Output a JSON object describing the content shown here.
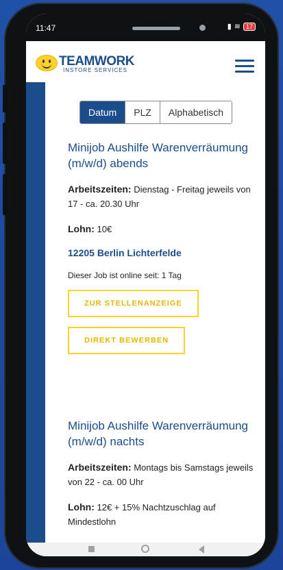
{
  "status": {
    "time": "11:47",
    "battery": "17"
  },
  "brand": {
    "name": "TEAMWORK",
    "tagline": "INSTORE SERVICES"
  },
  "sort": {
    "options": [
      "Datum",
      "PLZ",
      "Alphabetisch"
    ],
    "selected": "Datum"
  },
  "jobs": [
    {
      "title": "Minijob Aushilfe Warenverräumung (m/w/d) abends",
      "hours_label": "Arbeitszeiten:",
      "hours": " Dienstag - Freitag jeweils von 17 - ca. 20.30 Uhr",
      "pay_label": "Lohn:",
      "pay": " 10€",
      "location": "12205 Berlin Lichterfelde",
      "online": "Dieser Job ist online seit: 1 Tag",
      "btn_view": "ZUR STELLENANZEIGE",
      "btn_apply": "DIREKT BEWERBEN"
    },
    {
      "title": "Minijob Aushilfe Warenverräumung (m/w/d) nachts",
      "hours_label": "Arbeitszeiten:",
      "hours": " Montags bis Samstags jeweils von 22 - ca. 00 Uhr",
      "pay_label": "Lohn:",
      "pay": " 12€ + 15% Nachtzuschlag auf Mindestlohn"
    }
  ],
  "colors": {
    "brand_blue": "#1b4c8c",
    "accent_yellow": "#ffd12a"
  },
  "icons": {
    "menu": "hamburger-menu-icon",
    "nav": [
      "recent-apps-icon",
      "home-icon",
      "back-icon"
    ]
  }
}
